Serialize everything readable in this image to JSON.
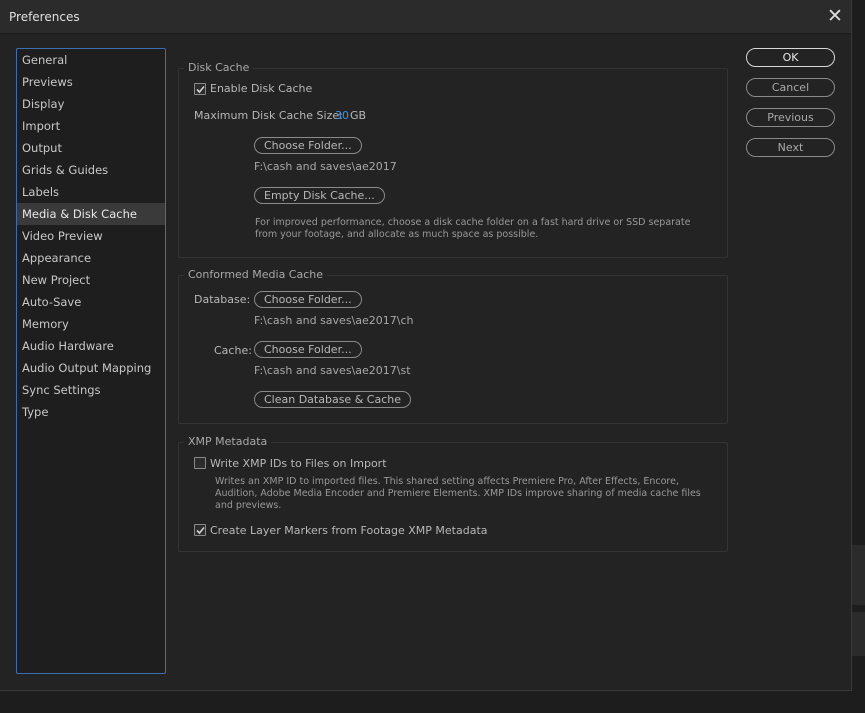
{
  "window": {
    "title": "Preferences"
  },
  "sidebar": {
    "items": [
      "General",
      "Previews",
      "Display",
      "Import",
      "Output",
      "Grids & Guides",
      "Labels",
      "Media & Disk Cache",
      "Video Preview",
      "Appearance",
      "New Project",
      "Auto-Save",
      "Memory",
      "Audio Hardware",
      "Audio Output Mapping",
      "Sync Settings",
      "Type"
    ],
    "selected": "Media & Disk Cache"
  },
  "disk_cache": {
    "title": "Disk Cache",
    "enable_label": "Enable Disk Cache",
    "enable_checked": true,
    "max_size_label": "Maximum Disk Cache Size:",
    "max_size_value": "30",
    "max_size_unit": "GB",
    "choose_folder": "Choose Folder...",
    "folder_path": "F:\\cash and saves\\ae2017",
    "empty_button": "Empty Disk Cache...",
    "info": "For improved performance, choose a disk cache folder on a fast hard drive or SSD separate from your footage, and allocate as much space as possible."
  },
  "conformed": {
    "title": "Conformed Media Cache",
    "database_label": "Database:",
    "database_button": "Choose Folder...",
    "database_path": "F:\\cash and saves\\ae2017\\ch",
    "cache_label": "Cache:",
    "cache_button": "Choose Folder...",
    "cache_path": "F:\\cash and saves\\ae2017\\st",
    "clean_button": "Clean Database & Cache"
  },
  "xmp": {
    "title": "XMP Metadata",
    "write_label": "Write XMP IDs to Files on Import",
    "write_checked": false,
    "write_info": "Writes an XMP ID to imported files. This shared setting affects Premiere Pro, After Effects, Encore, Audition, Adobe Media Encoder and Premiere Elements. XMP IDs improve sharing of media cache files and previews.",
    "markers_label": "Create Layer Markers from Footage XMP Metadata",
    "markers_checked": true
  },
  "buttons": {
    "ok": "OK",
    "cancel": "Cancel",
    "previous": "Previous",
    "next": "Next"
  },
  "colors": {
    "accent_blue": "#3a95e8",
    "sidebar_border": "#3d6fb0",
    "selected_bg": "#3a3a3a"
  }
}
